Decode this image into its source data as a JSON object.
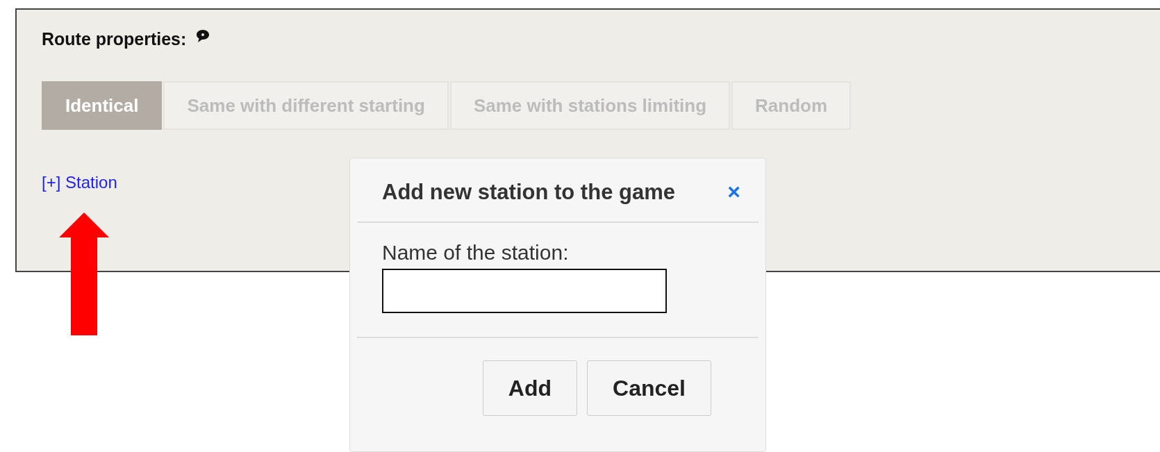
{
  "panel": {
    "title": "Route properties:"
  },
  "tabs": [
    {
      "label": "Identical",
      "selected": true
    },
    {
      "label": "Same with different starting",
      "selected": false
    },
    {
      "label": "Same with stations limiting",
      "selected": false
    },
    {
      "label": "Random",
      "selected": false
    }
  ],
  "add_link": "[+] Station",
  "dialog": {
    "title": "Add new station to the game",
    "close": "×",
    "field_label": "Name of the station:",
    "buttons": [
      "Add",
      "Cancel"
    ]
  }
}
